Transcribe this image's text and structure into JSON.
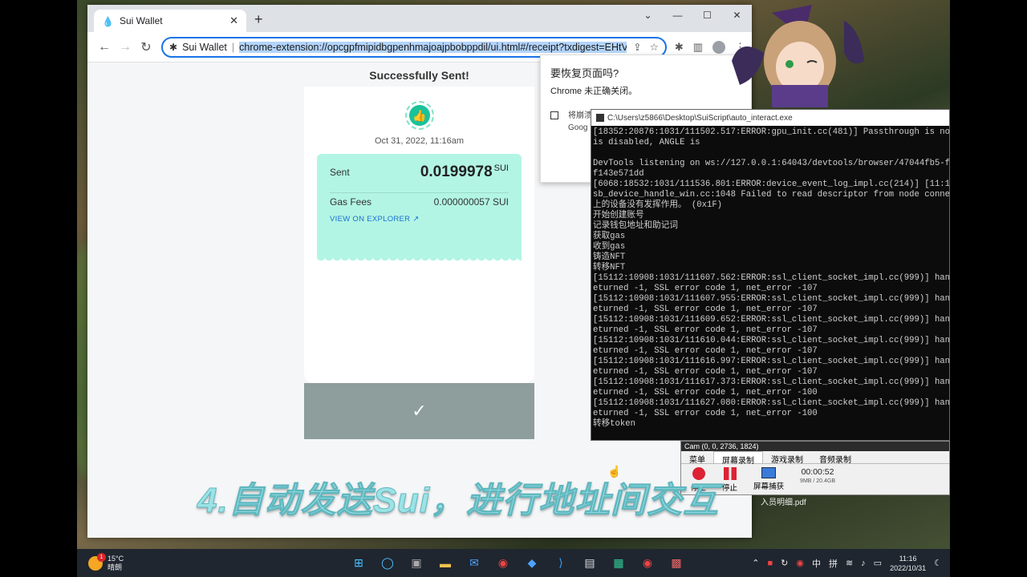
{
  "browser": {
    "tab_title": "Sui Wallet",
    "omnibox_site": "Sui Wallet",
    "url": "chrome-extension://opcgpfmipidbgpenhmajoajpbobppdil/ui.html#/receipt?txdigest=EHtV"
  },
  "wallet": {
    "title": "Successfully Sent!",
    "date": "Oct 31, 2022, 11:16am",
    "sent_label": "Sent",
    "sent_amount": "0.0199978",
    "sent_unit": "SUI",
    "gas_label": "Gas Fees",
    "gas_value": "0.000000057 SUI",
    "explorer_link": "VIEW ON EXPLORER",
    "done_icon": "✓"
  },
  "restore_prompt": {
    "title": "要恢复页面吗?",
    "body": "Chrome 未正确关闭。",
    "option_text": "将崩溃 Goog"
  },
  "console": {
    "title": "C:\\Users\\z5866\\Desktop\\SuiScript\\auto_interact.exe",
    "lines": "[18352:20876:1031/111502.517:ERROR:gpu_init.cc(481)] Passthrough is no\nis disabled, ANGLE is\n\nDevTools listening on ws://127.0.0.1:64043/devtools/browser/47044fb5-f\nf143e571dd\n[6068:18532:1031/111536.801:ERROR:device_event_log_impl.cc(214)] [11:1\nsb_device_handle_win.cc:1048 Failed to read descriptor from node conne\n上的设备没有发挥作用。 (0x1F)\n开始创建账号\n记录钱包地址和助记词\n获取gas\n收到gas\n铸造NFT\n转移NFT\n[15112:10908:1031/111607.562:ERROR:ssl_client_socket_impl.cc(999)] han\neturned -1, SSL error code 1, net_error -107\n[15112:10908:1031/111607.955:ERROR:ssl_client_socket_impl.cc(999)] han\neturned -1, SSL error code 1, net_error -107\n[15112:10908:1031/111609.652:ERROR:ssl_client_socket_impl.cc(999)] han\neturned -1, SSL error code 1, net_error -107\n[15112:10908:1031/111610.044:ERROR:ssl_client_socket_impl.cc(999)] han\neturned -1, SSL error code 1, net_error -107\n[15112:10908:1031/111616.997:ERROR:ssl_client_socket_impl.cc(999)] han\neturned -1, SSL error code 1, net_error -107\n[15112:10908:1031/111617.373:ERROR:ssl_client_socket_impl.cc(999)] han\neturned -1, SSL error code 1, net_error -100\n[15112:10908:1031/111627.080:ERROR:ssl_client_socket_impl.cc(999)] han\neturned -1, SSL error code 1, net_error -100\n转移token"
  },
  "recorder": {
    "title": "Cam (0, 0, 2736, 1824)",
    "tabs": [
      "菜单",
      "屏幕录制",
      "游戏录制",
      "音频录制"
    ],
    "btn_stop": "停止",
    "btn_pause": "停止",
    "btn_capture": "屏幕捕获",
    "time": "00:00:52",
    "size": "9MB / 20.4GB",
    "file_label": "入员明细.pdf"
  },
  "caption": "4.自动发送Sui，进行地址间交互",
  "taskbar": {
    "temperature": "15°C",
    "weather": "晴朗",
    "badge": "1",
    "ime": "中",
    "ime2": "拼",
    "time": "11:16",
    "date": "2022/10/31"
  },
  "colors": {
    "accent": "#18c39a",
    "receipt_bg": "#b2f5e4",
    "done_bar": "#8e9e9c",
    "link": "#1a6fd1"
  }
}
